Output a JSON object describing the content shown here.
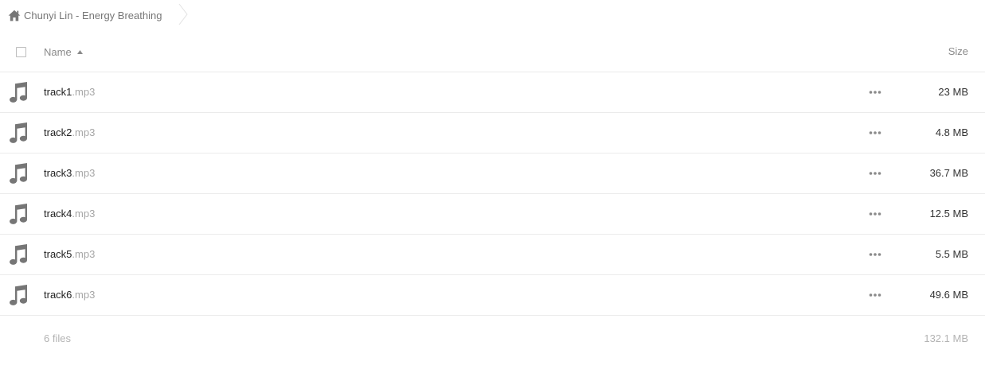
{
  "breadcrumb": {
    "folder": "Chunyi Lin - Energy Breathing",
    "icon": "home-icon"
  },
  "header": {
    "name_label": "Name",
    "size_label": "Size",
    "sort_direction": "ascending"
  },
  "files": [
    {
      "base": "track1",
      "ext": ".mp3",
      "size": "23 MB"
    },
    {
      "base": "track2",
      "ext": ".mp3",
      "size": "4.8 MB"
    },
    {
      "base": "track3",
      "ext": ".mp3",
      "size": "36.7 MB"
    },
    {
      "base": "track4",
      "ext": ".mp3",
      "size": "12.5 MB"
    },
    {
      "base": "track5",
      "ext": ".mp3",
      "size": "5.5 MB"
    },
    {
      "base": "track6",
      "ext": ".mp3",
      "size": "49.6 MB"
    }
  ],
  "summary": {
    "count": "6 files",
    "total_size": "132.1 MB"
  },
  "colors": {
    "icon_gray": "#767676",
    "border": "#ebebeb",
    "text_dark": "#222222",
    "text_muted": "#a6a6a6"
  }
}
